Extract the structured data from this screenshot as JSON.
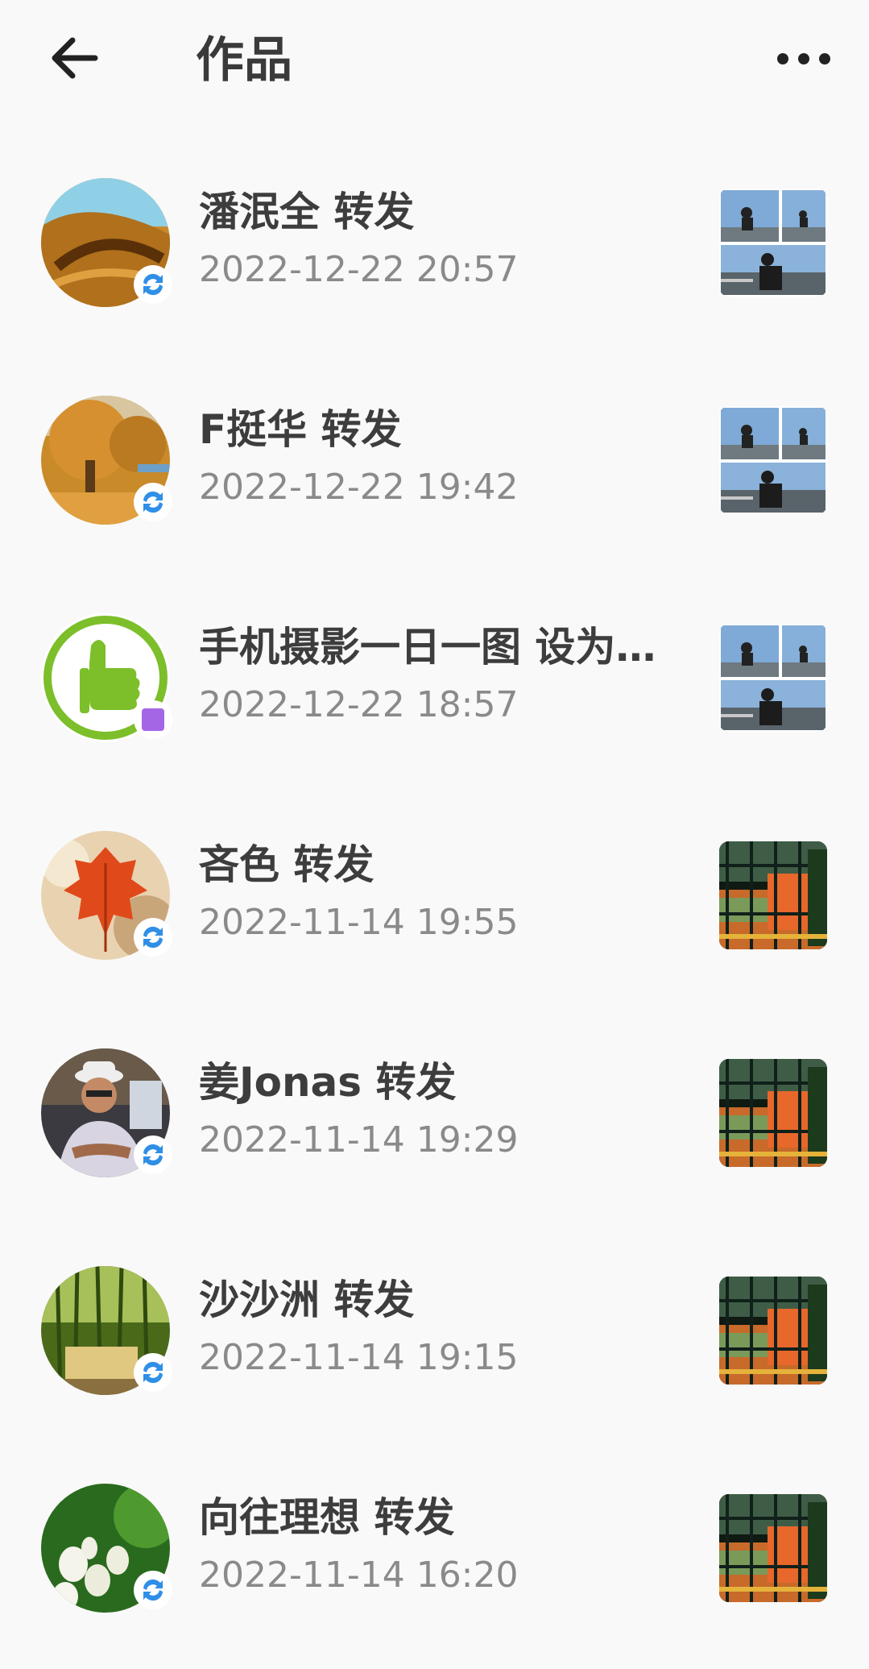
{
  "header": {
    "title": "作品",
    "back_icon": "arrow-left-icon",
    "more_icon": "more-horizontal-icon"
  },
  "items": [
    {
      "name": "潘泯全 转发",
      "time": "2022-12-22 20:57",
      "badge": "repost-icon",
      "thumb": "collage-man-sitting"
    },
    {
      "name": "F挺华 转发",
      "time": "2022-12-22 19:42",
      "badge": "repost-icon",
      "thumb": "collage-man-sitting"
    },
    {
      "name": "手机摄影一日一图 设为…",
      "time": "2022-12-22 18:57",
      "badge": "purple-square-icon",
      "thumb": "collage-man-sitting"
    },
    {
      "name": "吝色 转发",
      "time": "2022-11-14 19:55",
      "badge": "repost-icon",
      "thumb": "garden-fence-photo"
    },
    {
      "name": "姜Jonas 转发",
      "time": "2022-11-14 19:29",
      "badge": "repost-icon",
      "thumb": "garden-fence-photo"
    },
    {
      "name": "沙沙洲 转发",
      "time": "2022-11-14 19:15",
      "badge": "repost-icon",
      "thumb": "garden-fence-photo"
    },
    {
      "name": "向往理想 转发",
      "time": "2022-11-14 16:20",
      "badge": "repost-icon",
      "thumb": "garden-fence-photo"
    }
  ],
  "colors": {
    "repost_blue": "#2f8fe6",
    "purple_badge": "#a566e6",
    "background": "#f9f9f9"
  }
}
